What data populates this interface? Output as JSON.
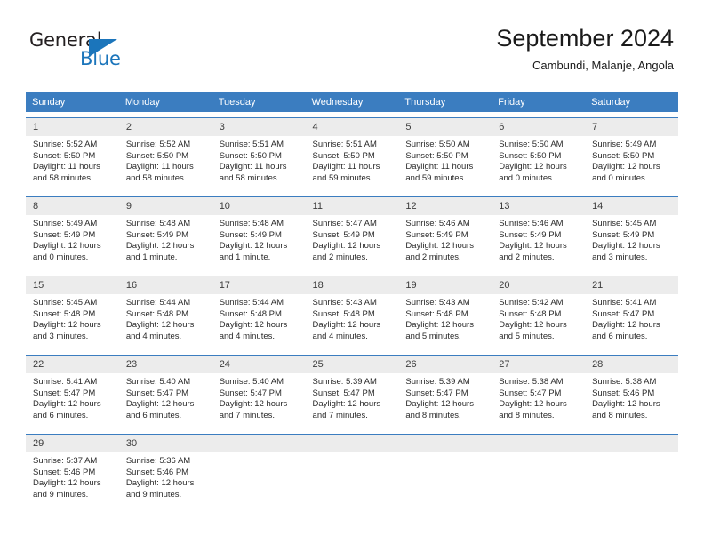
{
  "brand": {
    "name_top": "General",
    "name_bottom": "Blue",
    "triangle_icon": "triangle-icon",
    "accent_color": "#1b75bb"
  },
  "header": {
    "title": "September 2024",
    "subtitle": "Cambundi, Malanje, Angola"
  },
  "calendar": {
    "header_bg": "#3b7dc0",
    "day_band_bg": "#ececec",
    "weekdays": [
      "Sunday",
      "Monday",
      "Tuesday",
      "Wednesday",
      "Thursday",
      "Friday",
      "Saturday"
    ],
    "weeks": [
      [
        {
          "day": "1",
          "sunrise": "Sunrise: 5:52 AM",
          "sunset": "Sunset: 5:50 PM",
          "daylight_1": "Daylight: 11 hours",
          "daylight_2": "and 58 minutes."
        },
        {
          "day": "2",
          "sunrise": "Sunrise: 5:52 AM",
          "sunset": "Sunset: 5:50 PM",
          "daylight_1": "Daylight: 11 hours",
          "daylight_2": "and 58 minutes."
        },
        {
          "day": "3",
          "sunrise": "Sunrise: 5:51 AM",
          "sunset": "Sunset: 5:50 PM",
          "daylight_1": "Daylight: 11 hours",
          "daylight_2": "and 58 minutes."
        },
        {
          "day": "4",
          "sunrise": "Sunrise: 5:51 AM",
          "sunset": "Sunset: 5:50 PM",
          "daylight_1": "Daylight: 11 hours",
          "daylight_2": "and 59 minutes."
        },
        {
          "day": "5",
          "sunrise": "Sunrise: 5:50 AM",
          "sunset": "Sunset: 5:50 PM",
          "daylight_1": "Daylight: 11 hours",
          "daylight_2": "and 59 minutes."
        },
        {
          "day": "6",
          "sunrise": "Sunrise: 5:50 AM",
          "sunset": "Sunset: 5:50 PM",
          "daylight_1": "Daylight: 12 hours",
          "daylight_2": "and 0 minutes."
        },
        {
          "day": "7",
          "sunrise": "Sunrise: 5:49 AM",
          "sunset": "Sunset: 5:50 PM",
          "daylight_1": "Daylight: 12 hours",
          "daylight_2": "and 0 minutes."
        }
      ],
      [
        {
          "day": "8",
          "sunrise": "Sunrise: 5:49 AM",
          "sunset": "Sunset: 5:49 PM",
          "daylight_1": "Daylight: 12 hours",
          "daylight_2": "and 0 minutes."
        },
        {
          "day": "9",
          "sunrise": "Sunrise: 5:48 AM",
          "sunset": "Sunset: 5:49 PM",
          "daylight_1": "Daylight: 12 hours",
          "daylight_2": "and 1 minute."
        },
        {
          "day": "10",
          "sunrise": "Sunrise: 5:48 AM",
          "sunset": "Sunset: 5:49 PM",
          "daylight_1": "Daylight: 12 hours",
          "daylight_2": "and 1 minute."
        },
        {
          "day": "11",
          "sunrise": "Sunrise: 5:47 AM",
          "sunset": "Sunset: 5:49 PM",
          "daylight_1": "Daylight: 12 hours",
          "daylight_2": "and 2 minutes."
        },
        {
          "day": "12",
          "sunrise": "Sunrise: 5:46 AM",
          "sunset": "Sunset: 5:49 PM",
          "daylight_1": "Daylight: 12 hours",
          "daylight_2": "and 2 minutes."
        },
        {
          "day": "13",
          "sunrise": "Sunrise: 5:46 AM",
          "sunset": "Sunset: 5:49 PM",
          "daylight_1": "Daylight: 12 hours",
          "daylight_2": "and 2 minutes."
        },
        {
          "day": "14",
          "sunrise": "Sunrise: 5:45 AM",
          "sunset": "Sunset: 5:49 PM",
          "daylight_1": "Daylight: 12 hours",
          "daylight_2": "and 3 minutes."
        }
      ],
      [
        {
          "day": "15",
          "sunrise": "Sunrise: 5:45 AM",
          "sunset": "Sunset: 5:48 PM",
          "daylight_1": "Daylight: 12 hours",
          "daylight_2": "and 3 minutes."
        },
        {
          "day": "16",
          "sunrise": "Sunrise: 5:44 AM",
          "sunset": "Sunset: 5:48 PM",
          "daylight_1": "Daylight: 12 hours",
          "daylight_2": "and 4 minutes."
        },
        {
          "day": "17",
          "sunrise": "Sunrise: 5:44 AM",
          "sunset": "Sunset: 5:48 PM",
          "daylight_1": "Daylight: 12 hours",
          "daylight_2": "and 4 minutes."
        },
        {
          "day": "18",
          "sunrise": "Sunrise: 5:43 AM",
          "sunset": "Sunset: 5:48 PM",
          "daylight_1": "Daylight: 12 hours",
          "daylight_2": "and 4 minutes."
        },
        {
          "day": "19",
          "sunrise": "Sunrise: 5:43 AM",
          "sunset": "Sunset: 5:48 PM",
          "daylight_1": "Daylight: 12 hours",
          "daylight_2": "and 5 minutes."
        },
        {
          "day": "20",
          "sunrise": "Sunrise: 5:42 AM",
          "sunset": "Sunset: 5:48 PM",
          "daylight_1": "Daylight: 12 hours",
          "daylight_2": "and 5 minutes."
        },
        {
          "day": "21",
          "sunrise": "Sunrise: 5:41 AM",
          "sunset": "Sunset: 5:47 PM",
          "daylight_1": "Daylight: 12 hours",
          "daylight_2": "and 6 minutes."
        }
      ],
      [
        {
          "day": "22",
          "sunrise": "Sunrise: 5:41 AM",
          "sunset": "Sunset: 5:47 PM",
          "daylight_1": "Daylight: 12 hours",
          "daylight_2": "and 6 minutes."
        },
        {
          "day": "23",
          "sunrise": "Sunrise: 5:40 AM",
          "sunset": "Sunset: 5:47 PM",
          "daylight_1": "Daylight: 12 hours",
          "daylight_2": "and 6 minutes."
        },
        {
          "day": "24",
          "sunrise": "Sunrise: 5:40 AM",
          "sunset": "Sunset: 5:47 PM",
          "daylight_1": "Daylight: 12 hours",
          "daylight_2": "and 7 minutes."
        },
        {
          "day": "25",
          "sunrise": "Sunrise: 5:39 AM",
          "sunset": "Sunset: 5:47 PM",
          "daylight_1": "Daylight: 12 hours",
          "daylight_2": "and 7 minutes."
        },
        {
          "day": "26",
          "sunrise": "Sunrise: 5:39 AM",
          "sunset": "Sunset: 5:47 PM",
          "daylight_1": "Daylight: 12 hours",
          "daylight_2": "and 8 minutes."
        },
        {
          "day": "27",
          "sunrise": "Sunrise: 5:38 AM",
          "sunset": "Sunset: 5:47 PM",
          "daylight_1": "Daylight: 12 hours",
          "daylight_2": "and 8 minutes."
        },
        {
          "day": "28",
          "sunrise": "Sunrise: 5:38 AM",
          "sunset": "Sunset: 5:46 PM",
          "daylight_1": "Daylight: 12 hours",
          "daylight_2": "and 8 minutes."
        }
      ],
      [
        {
          "day": "29",
          "sunrise": "Sunrise: 5:37 AM",
          "sunset": "Sunset: 5:46 PM",
          "daylight_1": "Daylight: 12 hours",
          "daylight_2": "and 9 minutes."
        },
        {
          "day": "30",
          "sunrise": "Sunrise: 5:36 AM",
          "sunset": "Sunset: 5:46 PM",
          "daylight_1": "Daylight: 12 hours",
          "daylight_2": "and 9 minutes."
        },
        {
          "day": "",
          "sunrise": "",
          "sunset": "",
          "daylight_1": "",
          "daylight_2": ""
        },
        {
          "day": "",
          "sunrise": "",
          "sunset": "",
          "daylight_1": "",
          "daylight_2": ""
        },
        {
          "day": "",
          "sunrise": "",
          "sunset": "",
          "daylight_1": "",
          "daylight_2": ""
        },
        {
          "day": "",
          "sunrise": "",
          "sunset": "",
          "daylight_1": "",
          "daylight_2": ""
        },
        {
          "day": "",
          "sunrise": "",
          "sunset": "",
          "daylight_1": "",
          "daylight_2": ""
        }
      ]
    ]
  }
}
